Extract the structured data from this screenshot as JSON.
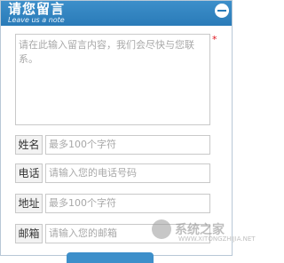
{
  "header": {
    "title": "请您留言",
    "subtitle": "Leave us a note"
  },
  "message": {
    "placeholder": "请在此输入留言内容，我们会尽快与您联系。",
    "required_mark": "*"
  },
  "fields": [
    {
      "label": "姓名",
      "placeholder": "最多100个字符"
    },
    {
      "label": "电话",
      "placeholder": "请输入您的电话号码"
    },
    {
      "label": "地址",
      "placeholder": "最多100个字符"
    },
    {
      "label": "邮箱",
      "placeholder": "请输入您的邮箱"
    }
  ],
  "watermark": {
    "text": "系统之家",
    "url": "WWW.XITONGZHIJIA.NET"
  },
  "colors": {
    "header_bg": "#2a7bb8",
    "required": "#e0141e",
    "border": "#c9c9c9",
    "placeholder_text": "#a8a8a8"
  }
}
